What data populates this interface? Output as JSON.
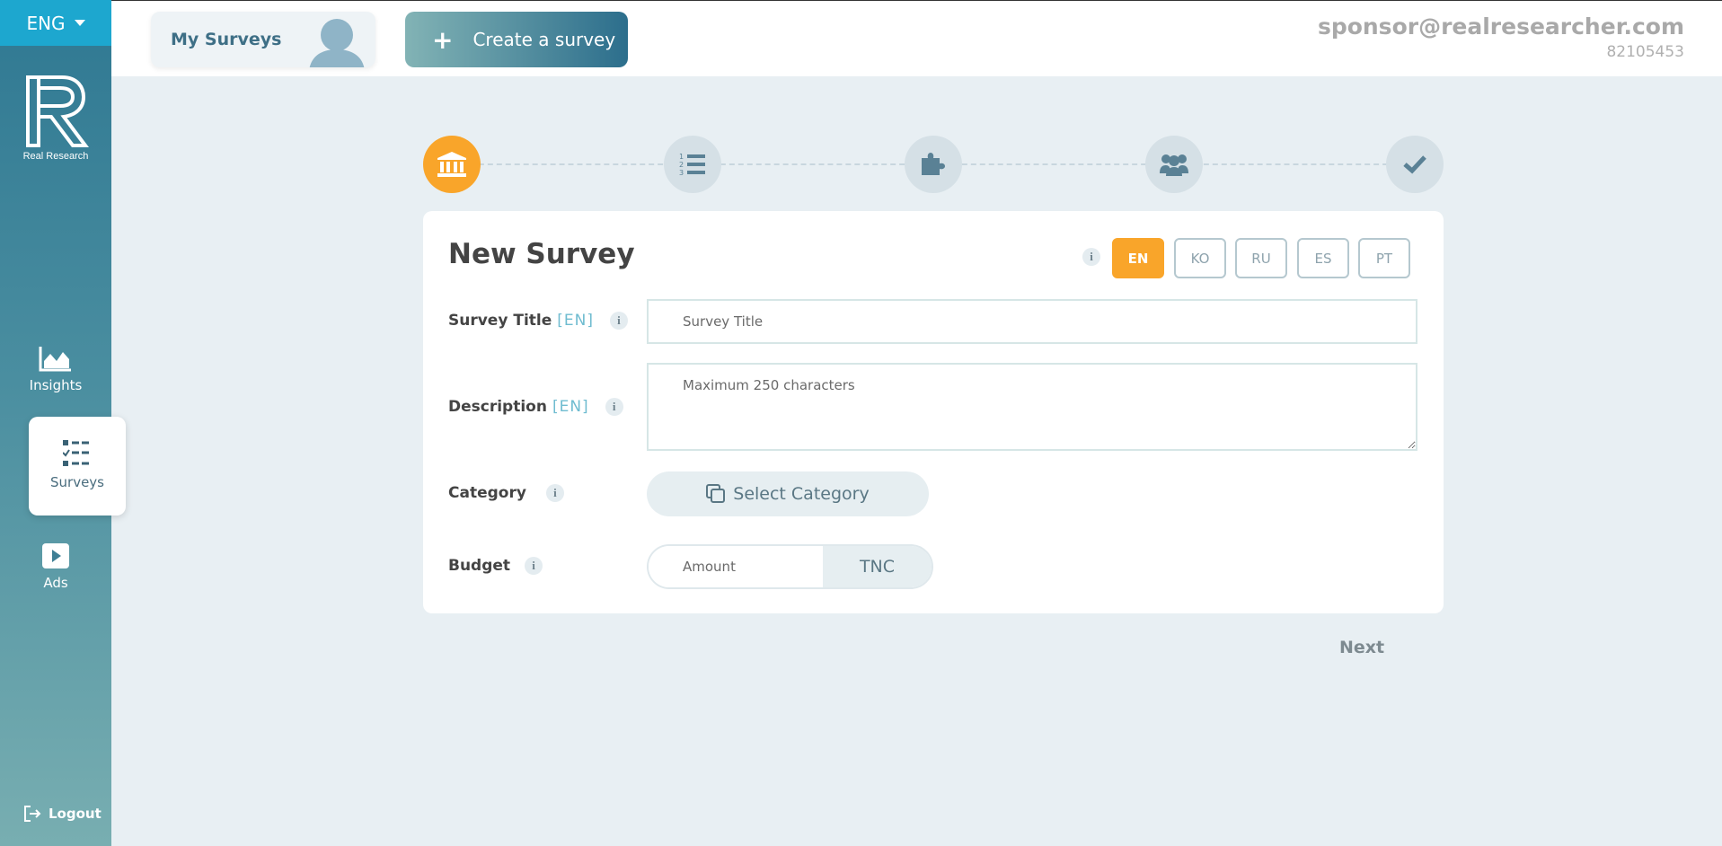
{
  "sidebar": {
    "language": "ENG",
    "logo_text": "Real Research",
    "items": [
      {
        "label": "Insights",
        "icon": "area-chart-icon"
      },
      {
        "label": "Surveys",
        "icon": "checklist-icon"
      },
      {
        "label": "Ads",
        "icon": "play-icon"
      }
    ],
    "logout_label": "Logout"
  },
  "topbar": {
    "my_surveys_label": "My Surveys",
    "create_label": "Create a survey",
    "email": "sponsor@realresearcher.com",
    "user_id": "82105453"
  },
  "stepper": {
    "steps": [
      {
        "icon": "bank-icon",
        "active": true
      },
      {
        "icon": "numbered-list-icon",
        "active": false
      },
      {
        "icon": "puzzle-icon",
        "active": false
      },
      {
        "icon": "users-icon",
        "active": false
      },
      {
        "icon": "check-icon",
        "active": false
      }
    ]
  },
  "form": {
    "title": "New Survey",
    "languages": [
      "EN",
      "KO",
      "RU",
      "ES",
      "PT"
    ],
    "active_language": "EN",
    "survey_title_label": "Survey Title",
    "survey_title_tag": "[EN]",
    "survey_title_placeholder": "Survey Title",
    "description_label": "Description",
    "description_tag": "[EN]",
    "description_placeholder": "Maximum 250 characters",
    "category_label": "Category",
    "category_button": "Select Category",
    "budget_label": "Budget",
    "budget_placeholder": "Amount",
    "budget_unit": "TNC",
    "info_glyph": "i"
  },
  "next_label": "Next",
  "colors": {
    "accent": "#f9a52a",
    "sidebar_top": "#2f7892",
    "lang_bar": "#1da7cf"
  }
}
